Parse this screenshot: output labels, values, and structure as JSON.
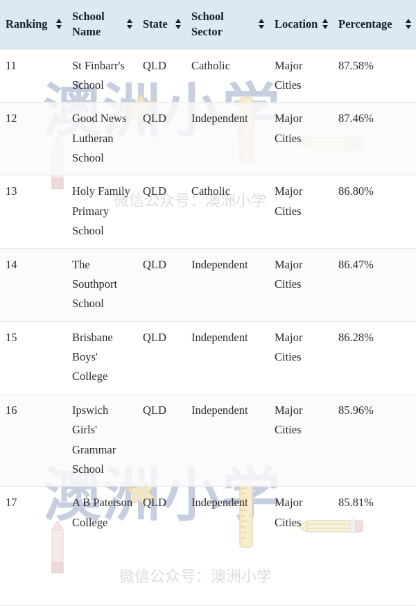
{
  "table": {
    "columns": [
      {
        "key": "ranking",
        "label": "Ranking",
        "sort_icon": "sort-updown-icon"
      },
      {
        "key": "school_name",
        "label": "School Name",
        "sort_icon": "sort-updown-icon"
      },
      {
        "key": "state",
        "label": "State",
        "sort_icon": "sort-updown-icon"
      },
      {
        "key": "school_sector",
        "label": "School Sector",
        "sort_icon": "sort-updown-icon"
      },
      {
        "key": "location",
        "label": "Location",
        "sort_icon": "sort-updown-icon"
      },
      {
        "key": "percentage",
        "label": "Percentage",
        "sort_icon": "sort-updown-icon"
      }
    ],
    "header_bg": "#dbe9f4",
    "rows": [
      {
        "ranking": "11",
        "school_name": "St Finbarr's School",
        "state": "QLD",
        "school_sector": "Catholic",
        "location": "Major Cities",
        "percentage": "87.58%"
      },
      {
        "ranking": "12",
        "school_name": "Good News Lutheran School",
        "state": "QLD",
        "school_sector": "Independent",
        "location": "Major Cities",
        "percentage": "87.46%"
      },
      {
        "ranking": "13",
        "school_name": "Holy Family Primary School",
        "state": "QLD",
        "school_sector": "Catholic",
        "location": "Major Cities",
        "percentage": "86.80%"
      },
      {
        "ranking": "14",
        "school_name": "The Southport School",
        "state": "QLD",
        "school_sector": "Independent",
        "location": "Major Cities",
        "percentage": "86.47%"
      },
      {
        "ranking": "15",
        "school_name": "Brisbane Boys' College",
        "state": "QLD",
        "school_sector": "Independent",
        "location": "Major Cities",
        "percentage": "86.28%"
      },
      {
        "ranking": "16",
        "school_name": "Ipswich Girls' Grammar School",
        "state": "QLD",
        "school_sector": "Independent",
        "location": "Major Cities",
        "percentage": "85.96%"
      },
      {
        "ranking": "17",
        "school_name": "A B Paterson College",
        "state": "QLD",
        "school_sector": "Independent",
        "location": "Major Cities",
        "percentage": "85.81%"
      }
    ]
  },
  "watermark": {
    "brand_text": "澳洲小学",
    "tagline_text": "微信公众号：澳洲小学",
    "brand_color": "#b9c4d8",
    "tagline_color": "#d9dde3",
    "accent_star_color": "#f2e6c8",
    "accent_pencil_color": "#f2dede",
    "accent_ruler_color": "#f7e8c4"
  }
}
